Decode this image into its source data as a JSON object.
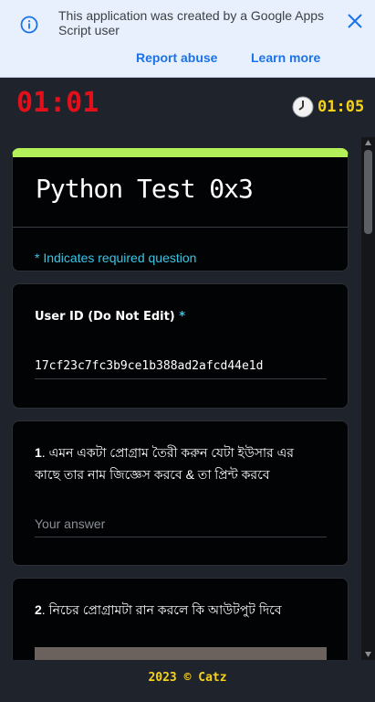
{
  "banner": {
    "message": "This application was created by a Google Apps Script user",
    "report_label": "Report abuse",
    "learn_label": "Learn more",
    "info_icon": "info-icon",
    "close_icon": "close-icon"
  },
  "timers": {
    "elapsed": "01:01",
    "remaining": "01:05",
    "clock_icon": "clock-icon"
  },
  "form": {
    "title": "Python Test 0x3",
    "required_note": "* Indicates required question",
    "accent_color": "#b4f05a",
    "questions": [
      {
        "label": "User ID (Do Not Edit)",
        "required_mark": "*",
        "value": "17cf23c7fc3b9ce1b388ad2afcd44e1d"
      },
      {
        "number": "1",
        "text_line1": "এমন একটা প্রোগ্রাম তৈরী করুন যেটা ইউসার এর",
        "text_line2": "কাছে তার নাম জিজ্ঞেস করবে & তা প্রিন্ট করবে",
        "placeholder": "Your answer"
      },
      {
        "number": "2",
        "text": "নিচের প্রোগ্রামটা রান করলে কি আউটপুট দিবে"
      }
    ]
  },
  "footer": {
    "text": "2023 © Catz"
  }
}
